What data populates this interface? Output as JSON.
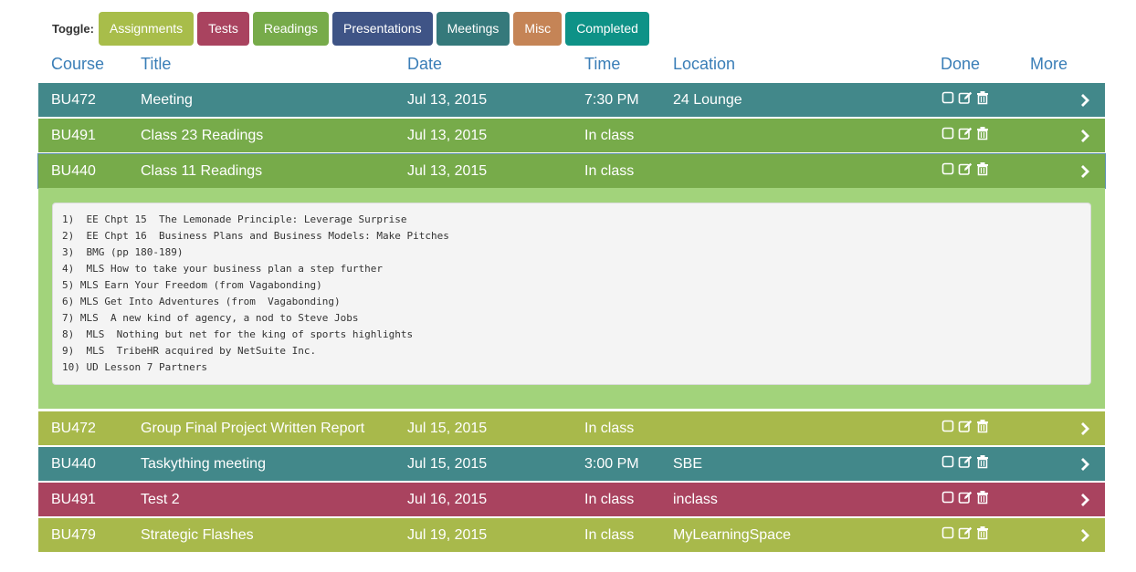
{
  "toggle": {
    "label": "Toggle:",
    "buttons": [
      {
        "label": "Assignments",
        "color": "#a8bd4a"
      },
      {
        "label": "Tests",
        "color": "#a9435f"
      },
      {
        "label": "Readings",
        "color": "#77ab4a"
      },
      {
        "label": "Presentations",
        "color": "#3f5486"
      },
      {
        "label": "Meetings",
        "color": "#35797b"
      },
      {
        "label": "Misc",
        "color": "#c58456"
      },
      {
        "label": "Completed",
        "color": "#0e9287"
      }
    ]
  },
  "headers": {
    "course": "Course",
    "title": "Title",
    "date": "Date",
    "time": "Time",
    "location": "Location",
    "done": "Done",
    "more": "More"
  },
  "rows": [
    {
      "course": "BU472",
      "title": "Meeting",
      "date": "Jul 13, 2015",
      "time": "7:30 PM",
      "location": "24 Lounge",
      "color": "#42888a"
    },
    {
      "course": "BU491",
      "title": "Class 23 Readings",
      "date": "Jul 13, 2015",
      "time": "In class",
      "location": "",
      "color": "#77ab4a"
    },
    {
      "course": "BU440",
      "title": "Class 11 Readings",
      "date": "Jul 13, 2015",
      "time": "In class",
      "location": "",
      "color": "#77ab4a"
    },
    {
      "course": "BU472",
      "title": "Group Final Project Written Report",
      "date": "Jul 15, 2015",
      "time": "In class",
      "location": "",
      "color": "#a8b94b"
    },
    {
      "course": "BU440",
      "title": "Taskything meeting",
      "date": "Jul 15, 2015",
      "time": "3:00 PM",
      "location": "SBE",
      "color": "#42888a"
    },
    {
      "course": "BU491",
      "title": "Test 2",
      "date": "Jul 16, 2015",
      "time": "In class",
      "location": "inclass",
      "color": "#a9435f"
    },
    {
      "course": "BU479",
      "title": "Strategic Flashes",
      "date": "Jul 19, 2015",
      "time": "In class",
      "location": "MyLearningSpace",
      "color": "#a8b94b"
    }
  ],
  "details": {
    "lines": [
      "1)  EE Chpt 15  The Lemonade Principle: Leverage Surprise",
      "2)  EE Chpt 16  Business Plans and Business Models: Make Pitches",
      "3)  BMG (pp 180-189)",
      "4)  MLS How to take your business plan a step further",
      "5) MLS Earn Your Freedom (from Vagabonding)",
      "6) MLS Get Into Adventures (from  Vagabonding)",
      "7) MLS  A new kind of agency, a nod to Steve Jobs",
      "8)  MLS  Nothing but net for the king of sports highlights",
      "9)  MLS  TribeHR acquired by NetSuite Inc.",
      "10) UD Lesson 7 Partners"
    ]
  },
  "icons": {
    "done": "checkbox-empty-icon",
    "edit": "edit-icon",
    "delete": "trash-icon",
    "more": "chevron-right-icon"
  }
}
